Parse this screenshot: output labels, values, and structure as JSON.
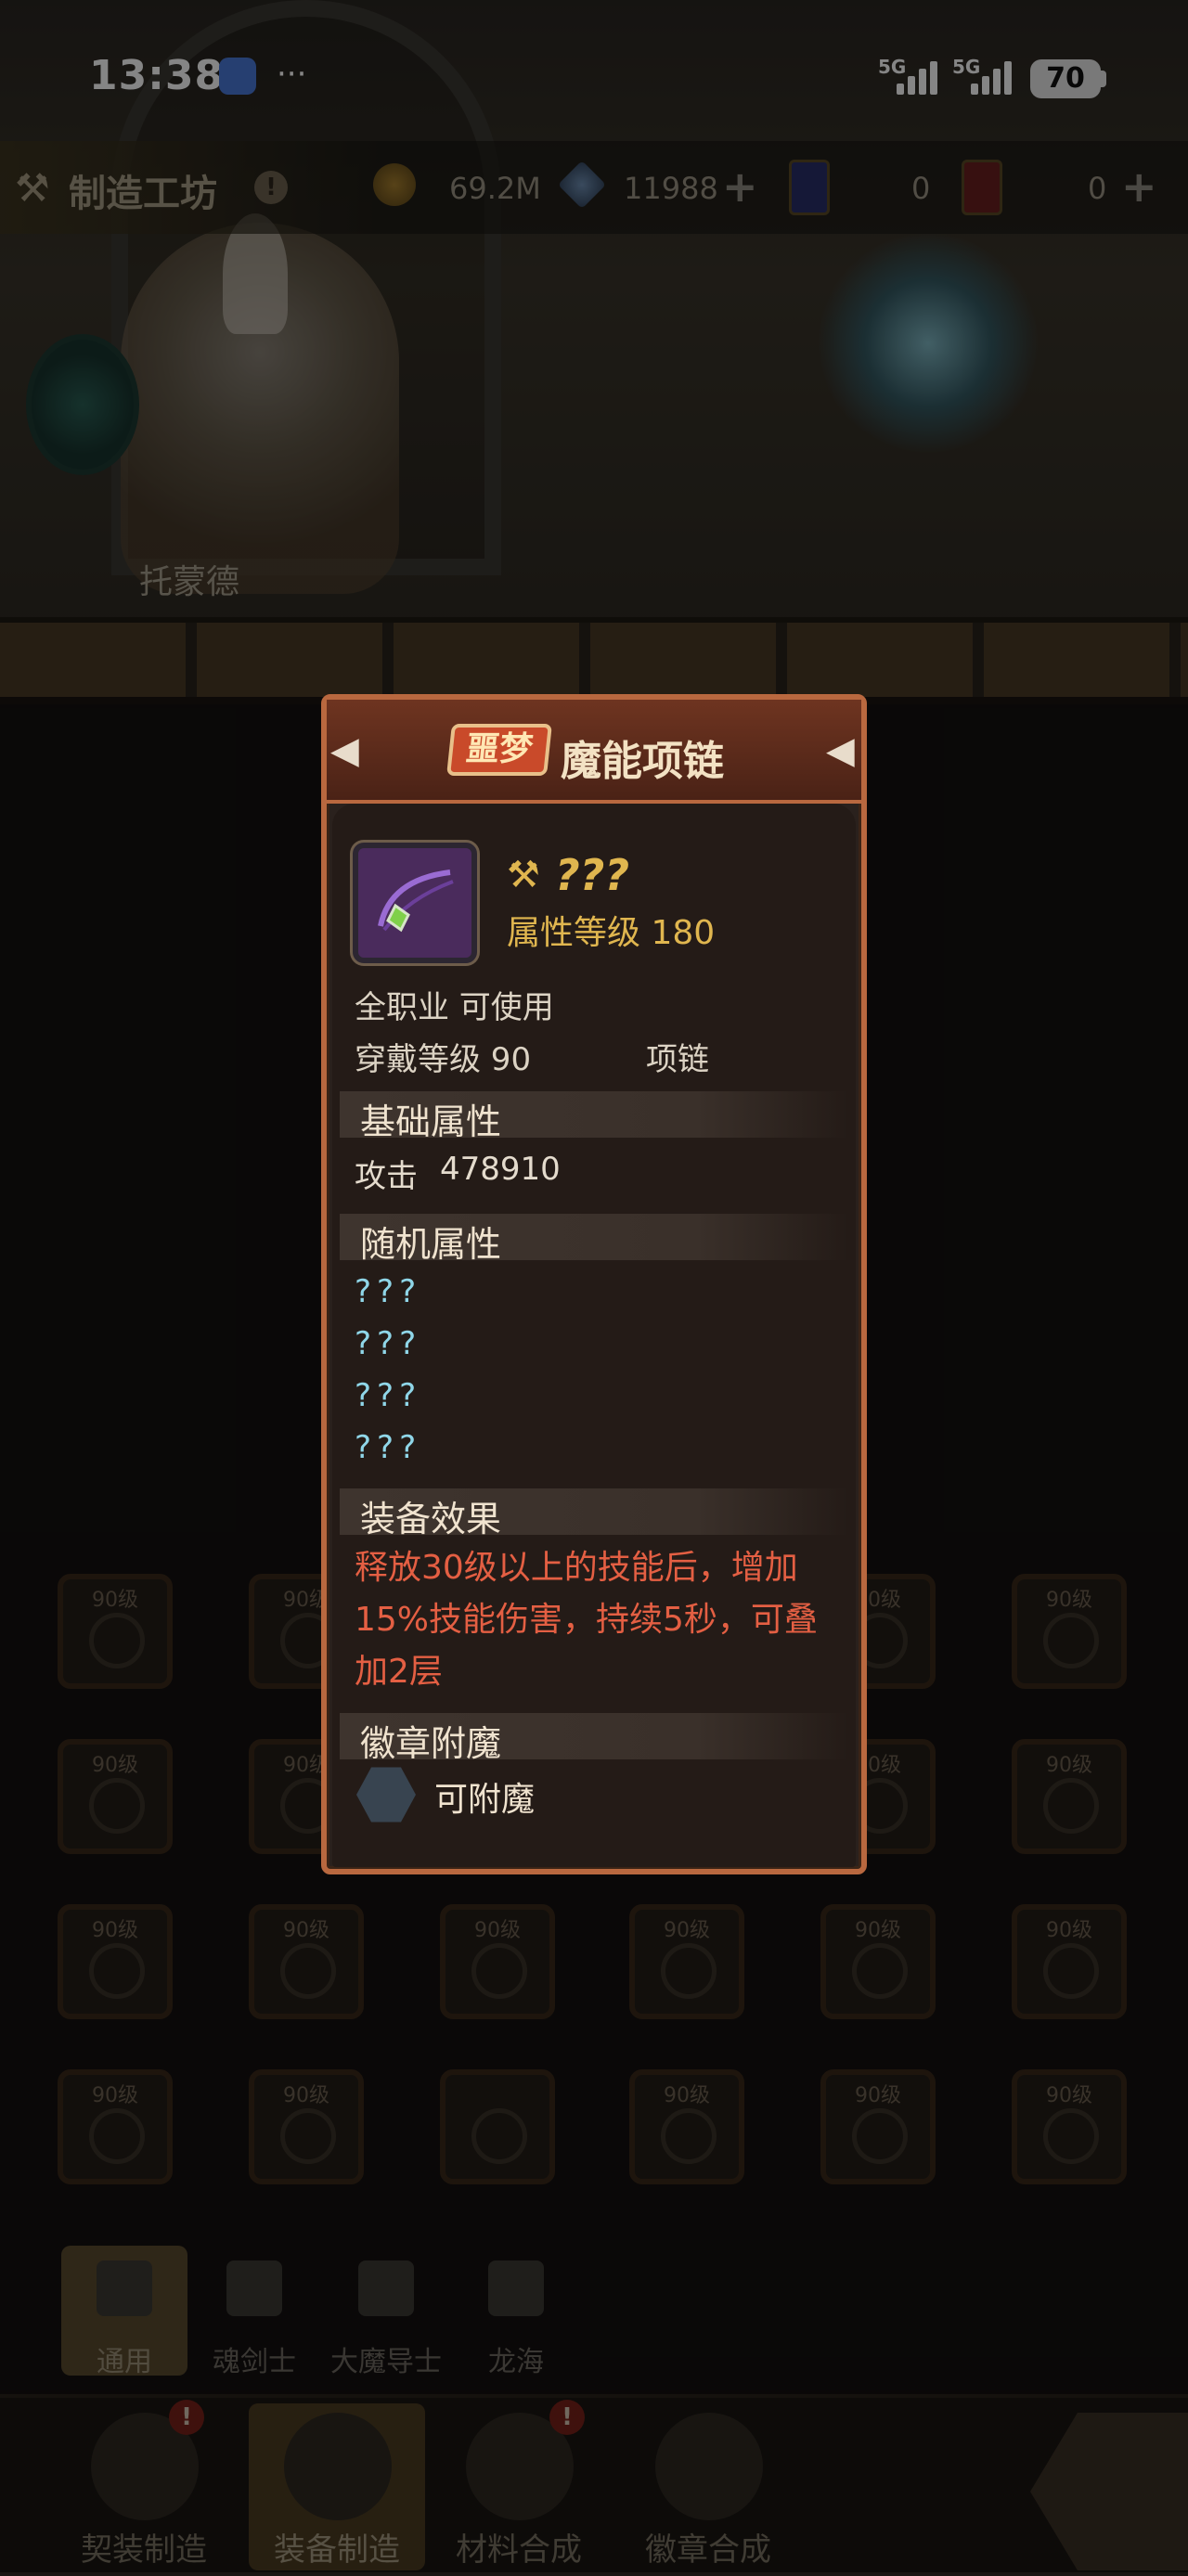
{
  "status_bar": {
    "time": "13:38",
    "more": "···",
    "signal_1": "5G",
    "signal_2": "5G",
    "battery": "70"
  },
  "top_bar": {
    "title": "制造工坊",
    "alert": "!",
    "gold": "69.2M",
    "crystal": "11988",
    "plus": "+",
    "ticket_1_count": "0",
    "ticket_2_count": "0"
  },
  "npc": {
    "name": "托蒙德"
  },
  "item": {
    "quality_badge": "噩梦",
    "name": "魔能项链",
    "unknown_name": "???",
    "attr_level": "属性等级 180",
    "job": "全职业 可使用",
    "wear_level": "穿戴等级 90",
    "slot_type": "项链",
    "sections": {
      "base": "基础属性",
      "random": "随机属性",
      "effect": "装备效果",
      "enchant": "徽章附魔"
    },
    "base_attr": {
      "label": "攻击",
      "value": "478910"
    },
    "random_attrs": [
      "???",
      "???",
      "???",
      "???"
    ],
    "effect": "释放30级以上的技能后，增加15%技能伤害，持续5秒，可叠加2层",
    "enchant_status": "可附魔"
  },
  "grid": {
    "level_label": "90级"
  },
  "category_tabs": [
    "通用",
    "魂剑士",
    "大魔导士",
    "龙海"
  ],
  "bottom_nav": {
    "items": [
      "契装制造",
      "装备制造",
      "材料合成",
      "徽章合成"
    ],
    "alert": "!"
  }
}
